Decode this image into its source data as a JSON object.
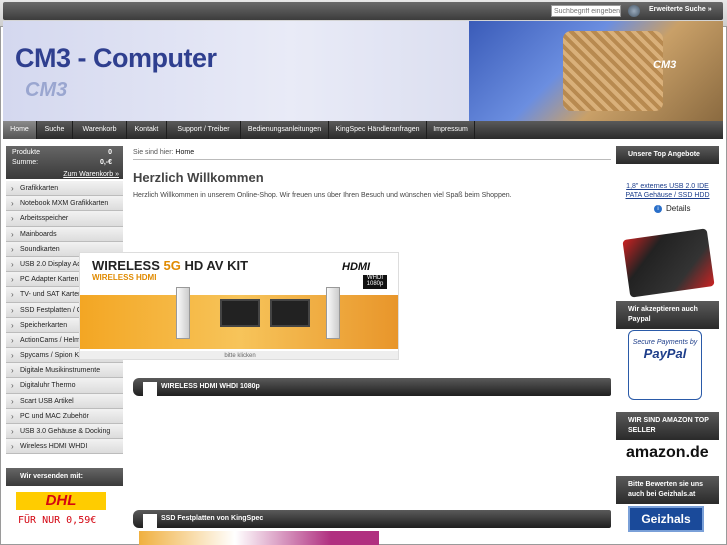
{
  "search": {
    "placeholder": "Suchbegriff eingeben",
    "advanced": "Erweiterte Suche »"
  },
  "brand": {
    "logo": "CM3 - Computer",
    "logo_shadow": "CM3",
    "gpu_label": "CM3"
  },
  "nav": [
    {
      "label": "Home"
    },
    {
      "label": "Suche"
    },
    {
      "label": "Warenkorb"
    },
    {
      "label": "Kontakt"
    },
    {
      "label": "Support / Treiber"
    },
    {
      "label": "Bedienungsanleitungen"
    },
    {
      "label": "KingSpec Händleranfragen"
    },
    {
      "label": "Impressum"
    }
  ],
  "cart": {
    "products_label": "Produkte",
    "products_value": "0",
    "sum_label": "Summe:",
    "sum_value": "0,-€",
    "link": "Zum Warenkorb »"
  },
  "categories": [
    "Grafikkarten",
    "Notebook MXM Grafikkarten",
    "Arbeitsspeicher",
    "Mainboards",
    "Soundkarten",
    "USB 2.0 Display Adapter",
    "PC Adapter Karten",
    "TV- und SAT Karten",
    "SSD Festplatten / Gehäuse",
    "Speicherkarten",
    "ActionCams / Helm Kameras",
    "Spycams / Spion Kameras",
    "Digitale Musikinstrumente",
    "Digitaluhr Thermo",
    "Scart USB Artikel",
    "PC und MAC Zubehör",
    "USB 3.0 Gehäuse & Docking",
    "Wireless HDMI WHDI"
  ],
  "shipping": {
    "title": "Wir versenden mit:",
    "dhl": "DHL",
    "price": "FÜR NUR 0,59€"
  },
  "main": {
    "breadcrumb_label": "Sie sind hier:",
    "breadcrumb_current": "Home",
    "title": "Herzlich Willkommen",
    "welcome": "Herzlich Willkommen in unserem Online-Shop. Wir freuen uns über Ihren Besuch und wünschen viel Spaß beim Shoppen.",
    "section1": "WIRELESS HDMI WHDI 1080p",
    "section2": "SSD Festplatten von KingSpec",
    "banner": {
      "title_a": "WIRELESS ",
      "title_b": "5G",
      "title_c": " HD AV KIT",
      "subtitle": "WIRELESS HDMI",
      "hdmi": "HDMI",
      "whdi": "WHDI 1080p",
      "caption": "bitte klicken"
    }
  },
  "right": {
    "top_offers": "Unsere Top Angebote",
    "product": "1,8\" externes USB 2.0 IDE PATA Gehäuse / SSD HDD",
    "details": "Details",
    "paypal_title": "Wir akzeptieren auch Paypal",
    "paypal_text": "Secure Payments by",
    "paypal_brand": "PayPal",
    "amazon_title": "WIR SIND AMAZON TOP SELLER",
    "amazon": "amazon.de",
    "geizhals_title": "Bitte Bewerten sie uns auch bei Geizhals.at",
    "geizhals": "Geizhals"
  }
}
